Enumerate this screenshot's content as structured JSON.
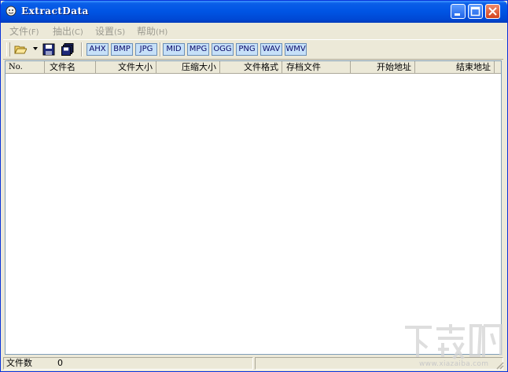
{
  "window": {
    "title": "ExtractData",
    "accent": "#0054e3",
    "face": "#ece9d8"
  },
  "menu": [
    {
      "label": "文件",
      "key": "(F)"
    },
    {
      "label": "抽出",
      "key": "(C)"
    },
    {
      "label": "设置",
      "key": "(S)"
    },
    {
      "label": "帮助",
      "key": "(H)"
    }
  ],
  "toolbar": {
    "icons": [
      "open-folder-icon",
      "dropdown-arrow-icon",
      "save-icon",
      "save-all-icon"
    ],
    "formats": [
      "AHX",
      "BMP",
      "JPG",
      "MID",
      "MPG",
      "OGG",
      "PNG",
      "WAV",
      "WMV"
    ]
  },
  "list": {
    "columns": [
      "No.",
      "文件名",
      "文件大小",
      "压缩大小",
      "文件格式",
      "存档文件",
      "开始地址",
      "结束地址"
    ],
    "rows": []
  },
  "status": {
    "count_label": "文件数",
    "count_value": "0"
  },
  "watermark": {
    "url": "www.xiazaiba.com"
  }
}
